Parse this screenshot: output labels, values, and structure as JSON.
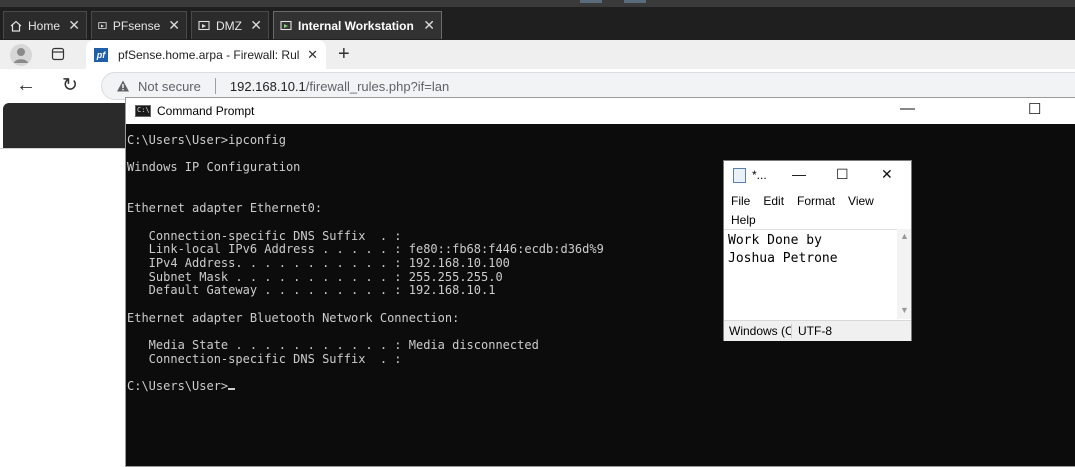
{
  "vm_tabs": [
    {
      "label": "Home",
      "icon": "home-icon"
    },
    {
      "label": "PFsense",
      "icon": "vm-icon"
    },
    {
      "label": "DMZ",
      "icon": "vm-icon"
    },
    {
      "label": "Internal Workstation",
      "icon": "vm-running-icon",
      "active": true
    }
  ],
  "browser": {
    "tab_title": "pfSense.home.arpa - Firewall: Rul",
    "favicon_text": "pf",
    "not_secure": "Not secure",
    "url_host": "192.168.10.1",
    "url_path": "/firewall_rules.php?if=lan"
  },
  "cmd": {
    "title": "Command Prompt",
    "lines": [
      "C:\\Users\\User>ipconfig",
      "",
      "Windows IP Configuration",
      "",
      "",
      "Ethernet adapter Ethernet0:",
      "",
      "   Connection-specific DNS Suffix  . :",
      "   Link-local IPv6 Address . . . . . : fe80::fb68:f446:ecdb:d36d%9",
      "   IPv4 Address. . . . . . . . . . . : 192.168.10.100",
      "   Subnet Mask . . . . . . . . . . . : 255.255.255.0",
      "   Default Gateway . . . . . . . . . : 192.168.10.1",
      "",
      "Ethernet adapter Bluetooth Network Connection:",
      "",
      "   Media State . . . . . . . . . . . : Media disconnected",
      "   Connection-specific DNS Suffix  . :",
      ""
    ],
    "prompt": "C:\\Users\\User>"
  },
  "notepad": {
    "title": "*...",
    "menu": [
      "File",
      "Edit",
      "Format",
      "View",
      "Help"
    ],
    "content": "Work Done by\nJoshua Petrone",
    "status_eol": "Windows (C",
    "status_encoding": "UTF-8"
  },
  "colors": {
    "console_bg": "#0c0c0c",
    "console_text": "#cccccc",
    "vm_strip": "#1f1f1f"
  }
}
